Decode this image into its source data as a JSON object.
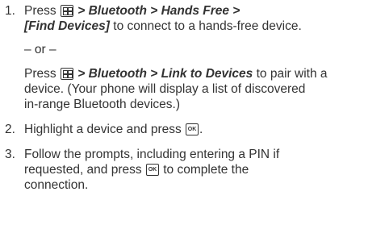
{
  "steps": [
    {
      "number": "1.",
      "line1_prefix": "Press",
      "line1_path": "> Bluetooth > Hands Free >",
      "line2_bracket": "[Find Devices]",
      "line2_rest": "to connect to a hands-free device.",
      "or_text": "– or –",
      "alt_prefix": "Press",
      "alt_path": "> Bluetooth > Link to Devices",
      "alt_rest": "to pair with a",
      "alt_line2": "device. (Your phone will display a list of discovered",
      "alt_line3": "in-range Bluetooth devices.)"
    },
    {
      "number": "2.",
      "text": "Highlight a device and press",
      "end": "."
    },
    {
      "number": "3.",
      "line1": "Follow the prompts, including entering a PIN if",
      "line2_prefix": "requested, and press",
      "line2_suffix": "to complete the",
      "line3": "connection."
    }
  ],
  "icons": {
    "menu_key": "menu-key-icon",
    "ok_key": "ok-key-icon",
    "ok_key_label": "OK"
  },
  "colors": {
    "text": "#333333",
    "background": "#ffffff"
  }
}
